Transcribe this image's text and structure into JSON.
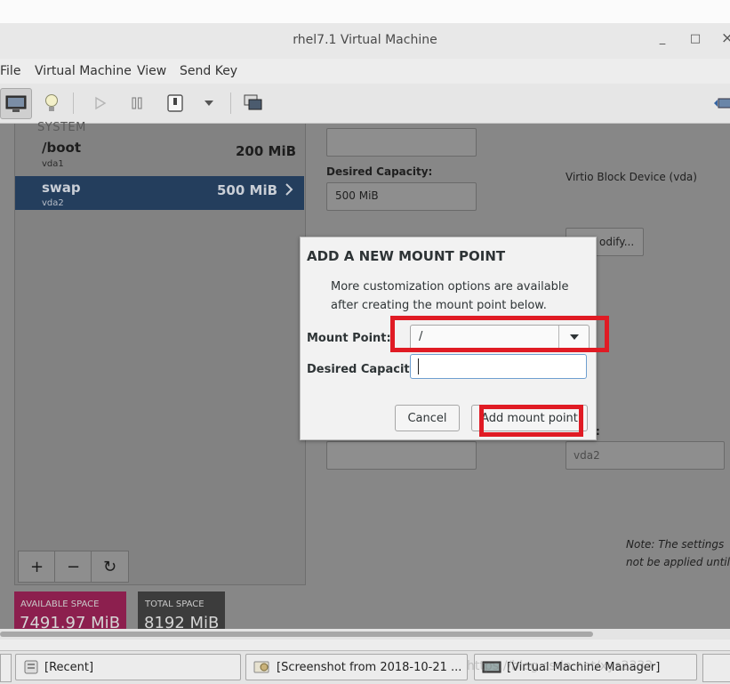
{
  "window": {
    "title": "rhel7.1 Virtual Machine",
    "controls": {
      "minimize": "_",
      "maximize": "□",
      "close": "×"
    }
  },
  "menubar": [
    "File",
    "Virtual Machine",
    "View",
    "Send Key"
  ],
  "toolbar": {
    "icons": [
      "console-icon",
      "details-lightbulb-icon",
      "run-icon",
      "pause-icon",
      "shutdown-icon",
      "shutdown-menu-icon",
      "snapshots-icon",
      "fullscreen-icon"
    ]
  },
  "guest": {
    "partition_list": {
      "section_label": "SYSTEM",
      "rows": [
        {
          "name": "/boot",
          "device": "vda1",
          "size": "200 MiB"
        },
        {
          "name": "swap",
          "device": "vda2",
          "size": "500 MiB"
        }
      ],
      "buttons": [
        "+",
        "−",
        "↻"
      ]
    },
    "details": {
      "desired_capacity_label": "Desired Capacity:",
      "desired_capacity_value": "500 MiB",
      "device_text": "Virtio Block Device (vda)",
      "modify_button_partial": "odify...",
      "name_partial_label": ":",
      "name_value": "vda2",
      "note_line1": "Note:  The settings",
      "note_line2": "not be applied until"
    },
    "space": {
      "available_label": "AVAILABLE SPACE",
      "available_value": "7491.97 MiB",
      "total_label": "TOTAL SPACE",
      "total_value": "8192 MiB"
    }
  },
  "dialog": {
    "title": "ADD A NEW MOUNT POINT",
    "description": "More customization options are available after creating the mount point below.",
    "mount_point_label": "Mount Point:",
    "mount_point_value": "/",
    "desired_capacity_label": "Desired Capacity:",
    "desired_capacity_value": "",
    "cancel_label": "Cancel",
    "add_label": "Add mount point"
  },
  "taskbar": {
    "items": [
      {
        "label": "[Recent]",
        "icon": "file-manager-icon"
      },
      {
        "label": "[Screenshot from 2018-10-21 ...",
        "icon": "image-viewer-icon"
      },
      {
        "label": "[Virtual Machine Manager]",
        "icon": "vm-manager-icon"
      }
    ],
    "watermark": "https://blog.csdn.net/xys2333"
  },
  "colors": {
    "annotation_red": "#e01b24",
    "selected_row": "#243e5d",
    "available_space_bg": "#8c1f4e"
  }
}
